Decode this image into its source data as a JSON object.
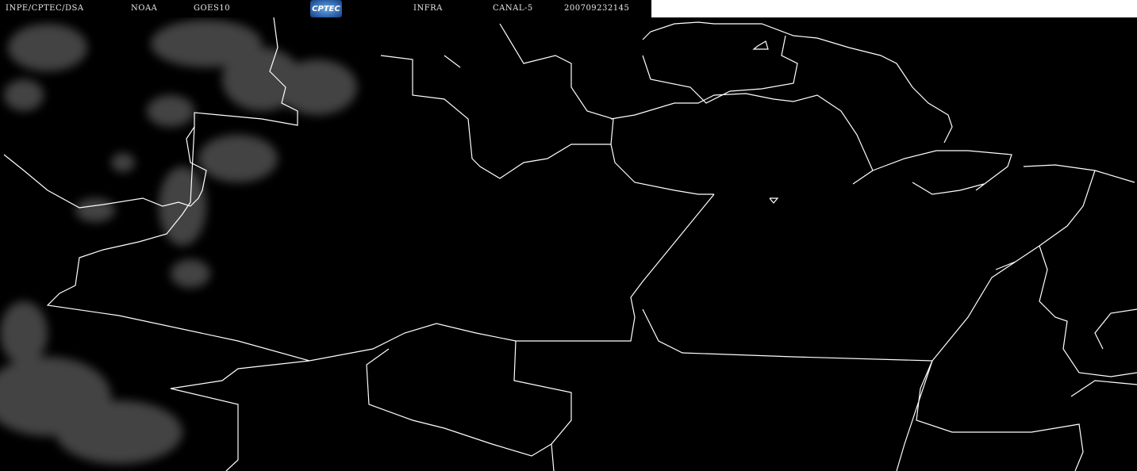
{
  "header": {
    "institution": "INPE/CPTEC/DSA",
    "agency": "NOAA",
    "satellite": "GOES10",
    "logo_text": "CPTEC",
    "band": "INFRA",
    "channel": "CANAL-5",
    "timestamp": "200709232145"
  },
  "colors": {
    "background": "#000000",
    "borders": "#ffffff",
    "clouds": "#8a8a8a"
  }
}
